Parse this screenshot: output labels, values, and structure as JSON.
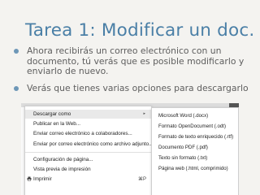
{
  "title": "Tarea 1: Modificar un doc.",
  "bullets": [
    "Ahora recibirás un correo electrónico con un documento, tú verás que es posible modificarlo y enviarlo de nuevo.",
    "Verás que tienes varias opciones para descargarlo"
  ],
  "menu": {
    "items": [
      {
        "label": "Descargar como",
        "has_submenu": true,
        "highlighted": true
      },
      {
        "label": "Publicar en la Web..."
      },
      {
        "label": "Enviar correo electrónico a colaboradores..."
      },
      {
        "label": "Enviar por correo electrónico como archivo adjunto..."
      },
      {
        "label": "Configuración de página..."
      },
      {
        "label": "Vista previa de impresión"
      },
      {
        "label": "Imprimir",
        "shortcut": "⌘P",
        "icon": "printer-icon"
      }
    ],
    "submenu_arrow": "▸"
  },
  "submenu": {
    "items": [
      "Microsoft Word (.docx)",
      "Formato OpenDocument (.odt)",
      "Formato de texto enriquecido (.rtf)",
      "Documento PDF (.pdf)",
      "Texto sin formato (.txt)",
      "Página web (.html, comprimido)"
    ]
  },
  "colors": {
    "title": "#4a7fa6",
    "bullet": "#6d97b7",
    "background": "#f4f3f0"
  }
}
